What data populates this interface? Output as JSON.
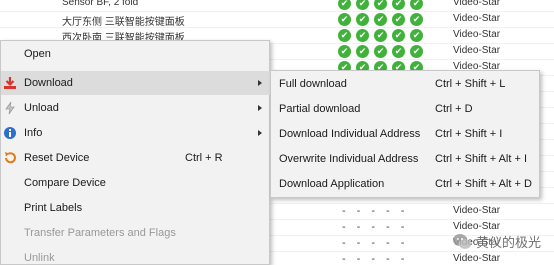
{
  "background_rows": [
    {
      "name": "Sensor BF, 2 fold",
      "checks": true,
      "manufacturer": "Video-Star"
    },
    {
      "name": "大厅东侧 三联智能按键面板",
      "checks": true,
      "manufacturer": "Video-Star"
    },
    {
      "name": "西次卧南 三联智能按键面板",
      "checks": true,
      "manufacturer": "Video-Star"
    },
    {
      "name": "",
      "checks": true,
      "manufacturer": "Video-Star"
    },
    {
      "name": "",
      "checks": true,
      "manufacturer": "Video-Star"
    },
    {
      "name": "",
      "checks": true,
      "manufacturer": "Video-Star"
    },
    {
      "name": "",
      "checks": true,
      "manufacturer": "Video-Star"
    },
    {
      "name": "",
      "checks": true,
      "manufacturer": "Video-Star"
    },
    {
      "name": "",
      "checks": true,
      "manufacturer": "Video-Star"
    },
    {
      "name": "",
      "checks": true,
      "manufacturer": "Video-Star"
    },
    {
      "name": "",
      "checks": true,
      "manufacturer": "Video-Star"
    },
    {
      "name": "",
      "checks": true,
      "manufacturer": "Video-Star"
    },
    {
      "name": "",
      "checks": false,
      "manufacturer": "Video-Star"
    },
    {
      "name": "",
      "checks": false,
      "manufacturer": "Video-Star"
    },
    {
      "name": "",
      "checks": false,
      "manufacturer": "Video-Star"
    },
    {
      "name": "",
      "checks": false,
      "manufacturer": "Video-Star"
    },
    {
      "name": "",
      "checks": false,
      "manufacturer": "Video-Star"
    }
  ],
  "check_glyph": "✔",
  "dash_glyph": "-",
  "context_menu": {
    "items": [
      {
        "label": "Open",
        "icon": "",
        "shortcut": "",
        "submenu": false,
        "disabled": false,
        "highlighted": false
      },
      {
        "label": "Download",
        "icon": "download-icon",
        "shortcut": "",
        "submenu": true,
        "disabled": false,
        "highlighted": true
      },
      {
        "label": "Unload",
        "icon": "unload-icon",
        "shortcut": "",
        "submenu": true,
        "disabled": false,
        "highlighted": false
      },
      {
        "label": "Info",
        "icon": "info-icon",
        "shortcut": "",
        "submenu": true,
        "disabled": false,
        "highlighted": false
      },
      {
        "label": "Reset Device",
        "icon": "reset-icon",
        "shortcut": "Ctrl + R",
        "submenu": false,
        "disabled": false,
        "highlighted": false
      },
      {
        "label": "Compare Device",
        "icon": "",
        "shortcut": "",
        "submenu": false,
        "disabled": false,
        "highlighted": false
      },
      {
        "label": "Print Labels",
        "icon": "",
        "shortcut": "",
        "submenu": false,
        "disabled": false,
        "highlighted": false
      },
      {
        "label": "Transfer Parameters and Flags",
        "icon": "",
        "shortcut": "",
        "submenu": false,
        "disabled": true,
        "highlighted": false
      },
      {
        "label": "Unlink",
        "icon": "",
        "shortcut": "",
        "submenu": false,
        "disabled": true,
        "highlighted": false
      }
    ]
  },
  "download_submenu": {
    "items": [
      {
        "label": "Full download",
        "shortcut": "Ctrl + Shift + L"
      },
      {
        "label": "Partial download",
        "shortcut": "Ctrl + D"
      },
      {
        "label": "Download Individual Address",
        "shortcut": "Ctrl + Shift + I"
      },
      {
        "label": "Overwrite Individual Address",
        "shortcut": "Ctrl + Shift + Alt + I"
      },
      {
        "label": "Download Application",
        "shortcut": "Ctrl + Shift + Alt + D"
      }
    ]
  },
  "watermark": {
    "text": "黄仪的极光"
  },
  "colors": {
    "check_green": "#3fb23a",
    "menu_bg": "#f2f2f2",
    "menu_highlight": "#dcdcdc",
    "disabled_text": "#999999",
    "download_icon_red": "#d9342b",
    "info_icon_blue": "#2a6fc9",
    "reset_icon_orange": "#e07b1a"
  }
}
